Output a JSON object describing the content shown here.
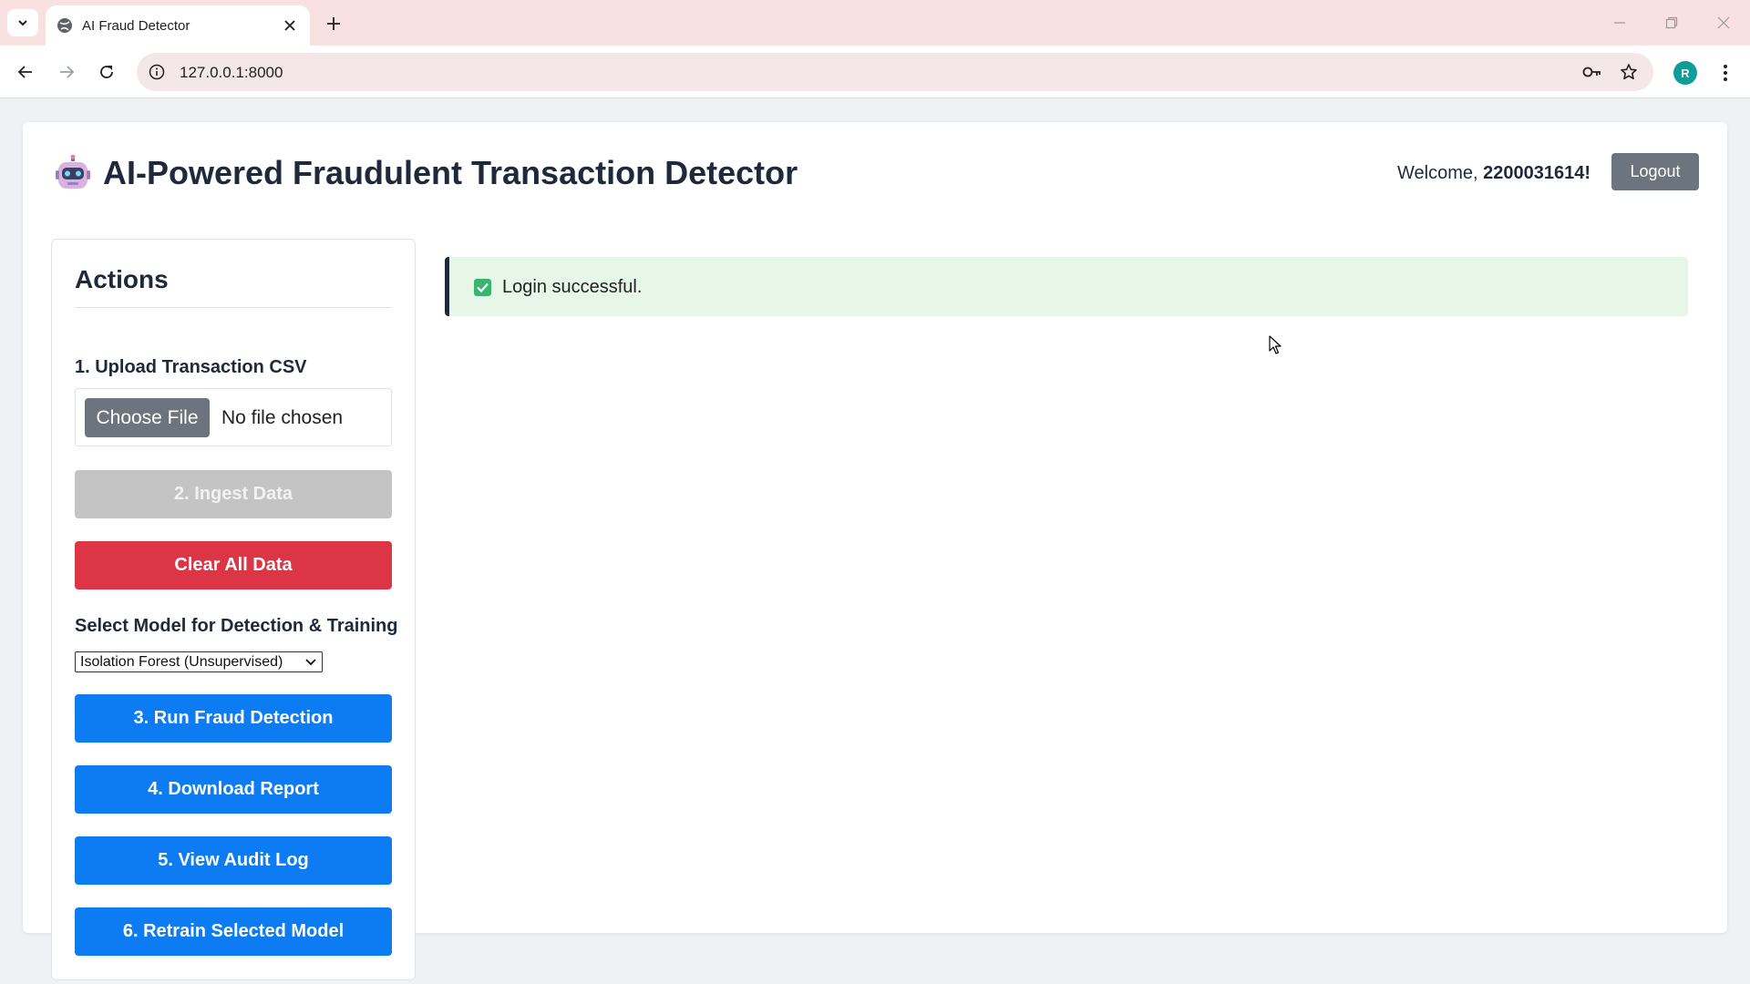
{
  "browser": {
    "tab_title": "AI Fraud Detector",
    "url": "127.0.0.1:8000",
    "profile_initial": "R",
    "icons": [
      "tab-list-icon",
      "globe-icon",
      "close-icon",
      "plus-icon",
      "minimize-icon",
      "restore-icon",
      "back-icon",
      "forward-icon",
      "reload-icon",
      "info-icon",
      "key-icon",
      "star-icon",
      "more-vert-icon"
    ]
  },
  "header": {
    "title": "AI-Powered Fraudulent Transaction Detector",
    "welcome_prefix": "Welcome, ",
    "username": "2200031614",
    "welcome_suffix": "!",
    "logout_label": "Logout",
    "logo_icon": "robot-icon"
  },
  "sidebar": {
    "title": "Actions",
    "upload_label": "1. Upload Transaction CSV",
    "choose_file_label": "Choose File",
    "no_file_text": "No file chosen",
    "ingest_label": "2. Ingest Data",
    "clear_label": "Clear All Data",
    "model_label": "Select Model for Detection & Training",
    "model_selected": "Isolation Forest (Unsupervised)",
    "run_label": "3. Run Fraud Detection",
    "download_label": "4. Download Report",
    "audit_label": "5. View Audit Log",
    "retrain_label": "6. Retrain Selected Model"
  },
  "alert": {
    "message": "Login successful.",
    "icon": "check-icon"
  },
  "colors": {
    "primary": "#0d7cf2",
    "danger": "#dc3545",
    "secondary": "#6c757d",
    "success_bg": "#e7f7e7",
    "tabstrip": "#f8e1e0"
  }
}
